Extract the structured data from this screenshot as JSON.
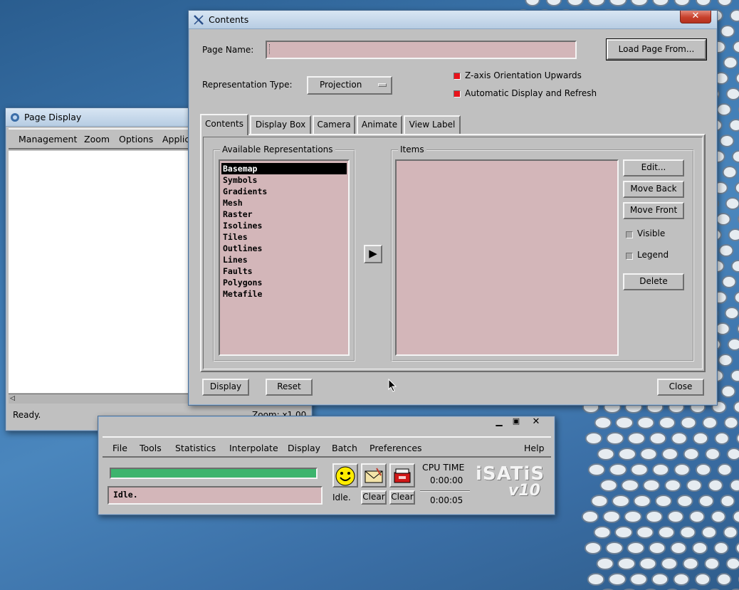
{
  "colors": {
    "accent_red": "#e8131b",
    "field_pink": "#d3b6b9",
    "progress_green": "#3db46d"
  },
  "page_display": {
    "title": "Page Display",
    "menu": [
      "Management",
      "Zoom",
      "Options",
      "Applic"
    ],
    "status": "Ready.",
    "zoom": "Zoom: x1.00"
  },
  "contents": {
    "title": "Contents",
    "page_name_label": "Page Name:",
    "page_name_value": "",
    "load_button": "Load Page From...",
    "rep_type_label": "Representation Type:",
    "rep_type_value": "Projection",
    "z_axis": "Z-axis Orientation Upwards",
    "auto_display": "Automatic Display and Refresh",
    "tabs": [
      "Contents",
      "Display Box",
      "Camera",
      "Animate",
      "View Label"
    ],
    "available_title": "Available Representations",
    "representations": [
      "Basemap",
      "Symbols",
      "Gradients",
      "Mesh",
      "Raster",
      "Isolines",
      "Tiles",
      "Outlines",
      "Lines",
      "Faults",
      "Polygons",
      "Metafile"
    ],
    "items_title": "Items",
    "edit": "Edit...",
    "move_back": "Move Back",
    "move_front": "Move Front",
    "visible": "Visible",
    "legend": "Legend",
    "delete": "Delete",
    "display": "Display",
    "reset": "Reset",
    "close": "Close"
  },
  "isatis": {
    "menu": [
      "File",
      "Tools",
      "Statistics",
      "Interpolate",
      "Display",
      "Batch",
      "Preferences",
      "Help"
    ],
    "status": "Idle.",
    "idle_label": "Idle.",
    "clear1": "Clear",
    "clear2": "Clear",
    "cpu_label": "CPU TIME",
    "cpu_time": "0:00:00",
    "elapsed_time": "0:00:05",
    "logo": "iSATiS",
    "version": "v10",
    "progress": 1.0
  }
}
